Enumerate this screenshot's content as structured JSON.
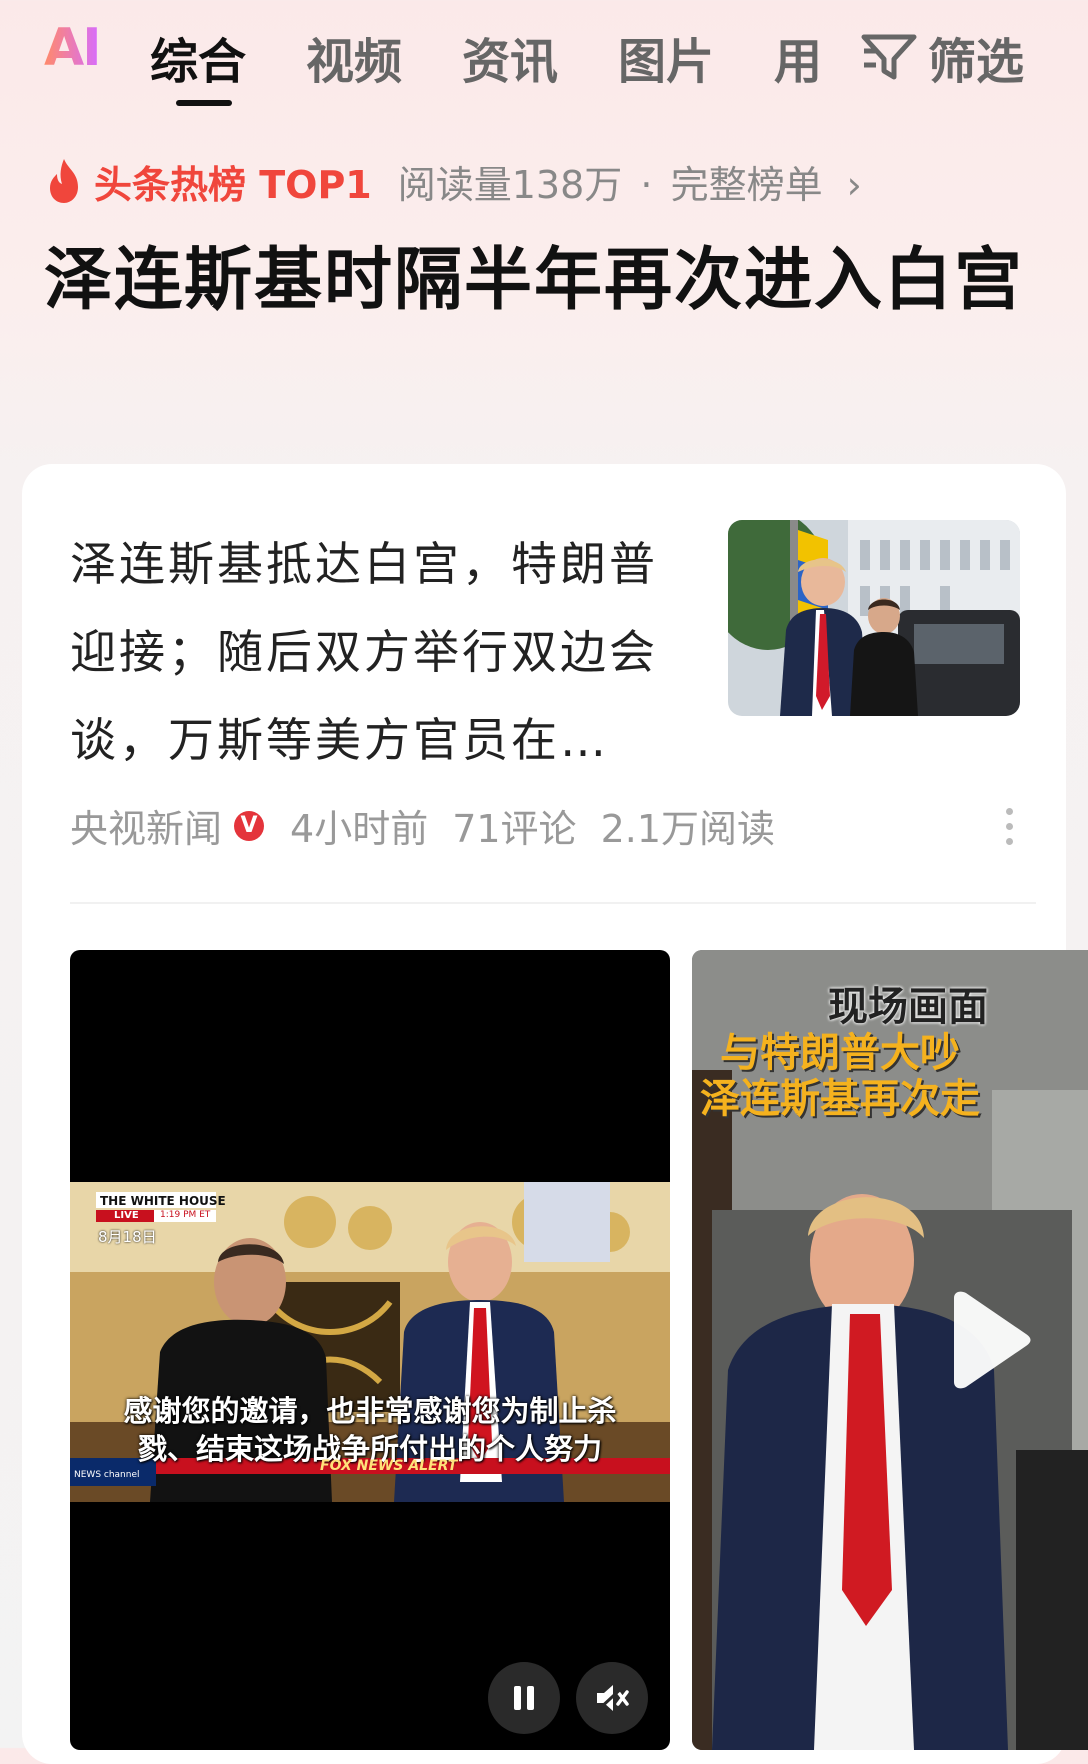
{
  "tabs": {
    "ai_label": "AI",
    "items": [
      {
        "label": "综合",
        "active": true
      },
      {
        "label": "视频",
        "active": false
      },
      {
        "label": "资讯",
        "active": false
      },
      {
        "label": "图片",
        "active": false
      },
      {
        "label": "用",
        "active": false
      }
    ],
    "filter_label": "筛选"
  },
  "hot": {
    "label": "头条热榜 TOP1",
    "reads": "阅读量138万",
    "separator": "·",
    "full_list": "完整榜单",
    "chevron": "›"
  },
  "headline": "泽连斯基时隔半年再次进入白宫",
  "article": {
    "text": "泽连斯基抵达白宫，特朗普迎接；随后双方举行双边会谈，万斯等美方官员在场……",
    "source": "央视新闻",
    "verified_badge": "V",
    "time": "4小时前",
    "comments": "71评论",
    "reads": "2.1万阅读"
  },
  "video1": {
    "channel_tag": "THE WHITE HOUSE",
    "live_tag": "LIVE",
    "time_tag": "1:19 PM ET",
    "date_tag": "8月18日",
    "subtitle_line1": "感谢您的邀请，也非常感谢您为制止杀",
    "subtitle_line2": "戮、结束这场战争所付出的个人努力",
    "news_bar": "FOX NEWS ALERT",
    "news_logo": "NEWS channel"
  },
  "video2": {
    "overlay_line1": "现场画面",
    "overlay_line2": "与特朗普大吵",
    "overlay_line3": "泽连斯基再次走"
  },
  "colors": {
    "accent_red": "#f0463c",
    "verified_red": "#e4343b",
    "overlay_yellow": "#f5b21e"
  },
  "icons": [
    "filter-icon",
    "flame-icon",
    "verified-icon",
    "more-icon",
    "pause-icon",
    "mute-icon",
    "play-icon"
  ]
}
